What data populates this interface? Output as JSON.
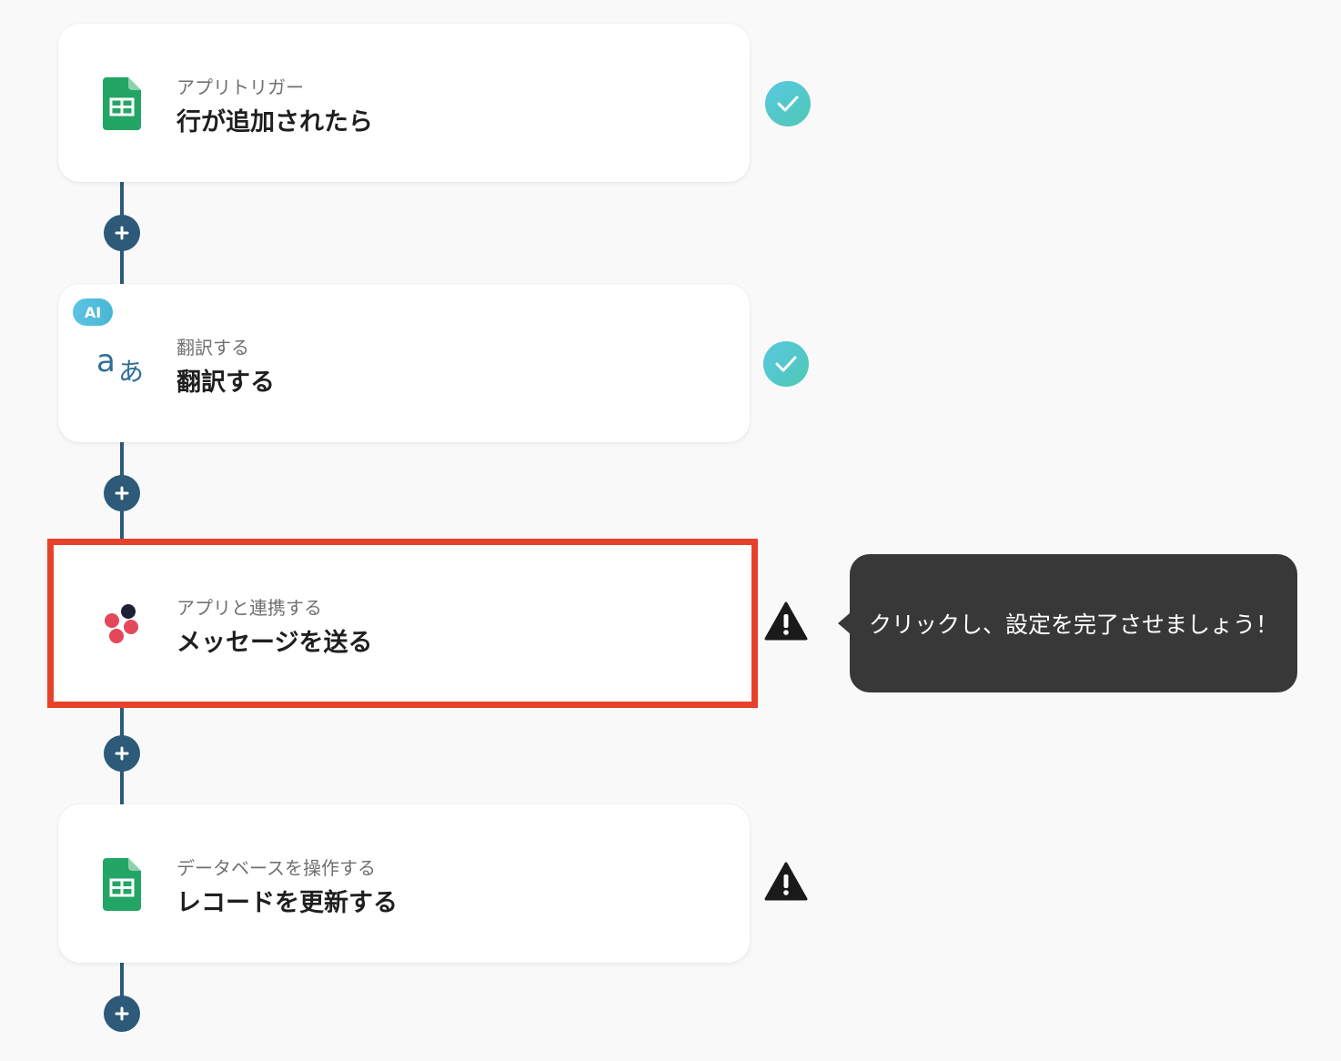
{
  "steps": [
    {
      "subtitle": "アプリトリガー",
      "title": "行が追加されたら",
      "icon": "google-sheets-icon",
      "status": "complete"
    },
    {
      "badge": "AI",
      "subtitle": "翻訳する",
      "title": "翻訳する",
      "icon": "translate-icon",
      "status": "complete"
    },
    {
      "subtitle": "アプリと連携する",
      "title": "メッセージを送る",
      "icon": "messaging-app-icon",
      "status": "warning",
      "highlighted": true
    },
    {
      "subtitle": "データベースを操作する",
      "title": "レコードを更新する",
      "icon": "google-sheets-icon",
      "status": "warning"
    }
  ],
  "tooltip": {
    "text": "クリックし、設定を完了させましょう！"
  },
  "colors": {
    "connector": "#2c5a78",
    "highlight": "#e8412b",
    "check": "#55c6d9",
    "tooltip_bg": "#383838",
    "sheets_green": "#23a566"
  }
}
